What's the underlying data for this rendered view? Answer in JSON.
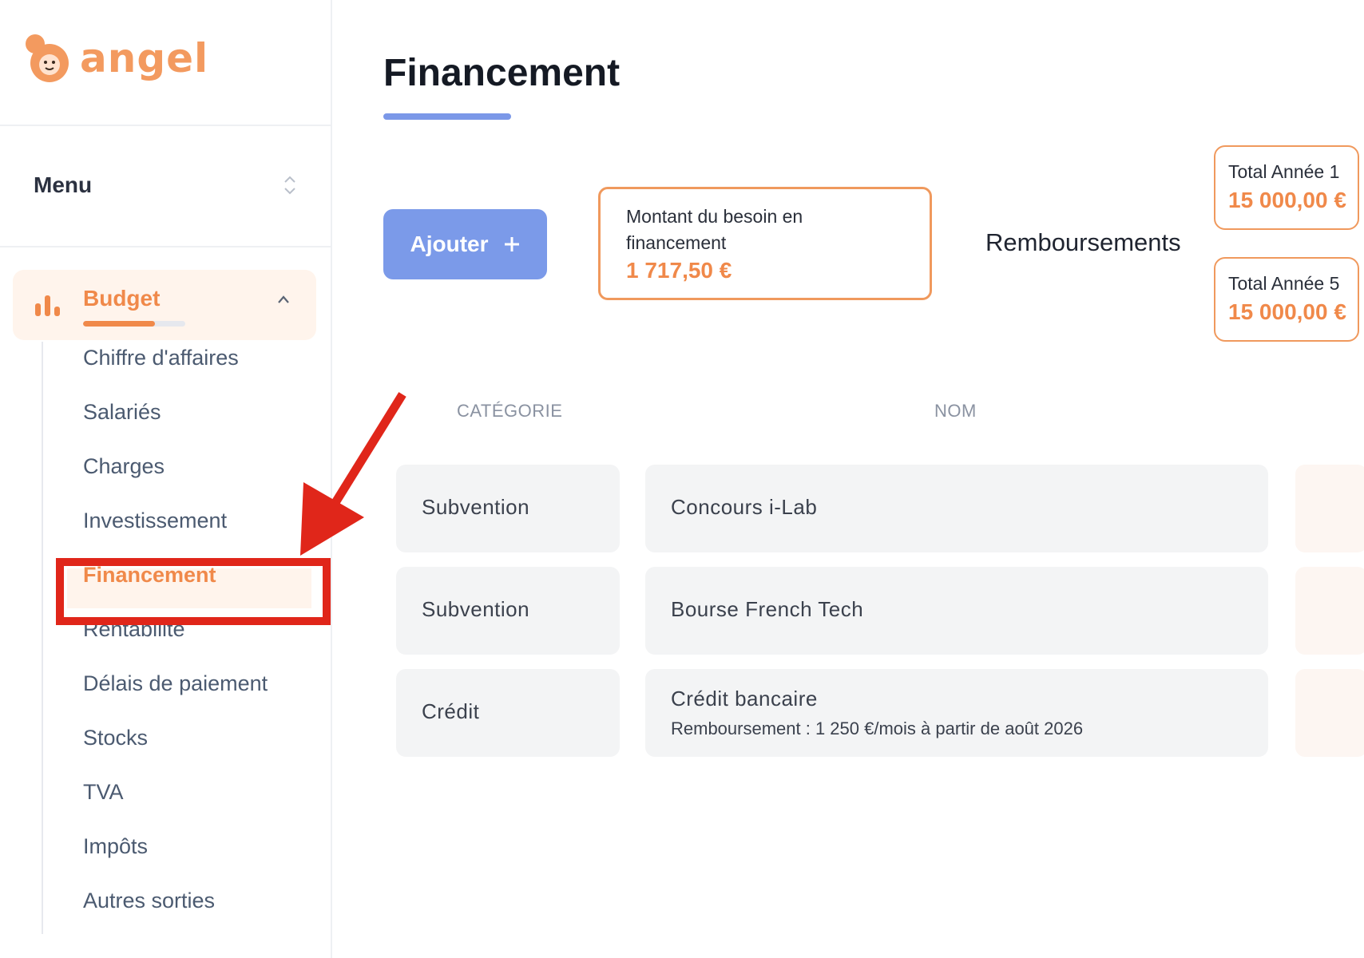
{
  "brand": {
    "name": "angel",
    "color": "#f0894a"
  },
  "sidebar": {
    "menu_label": "Menu",
    "budget_label": "Budget",
    "budget_progress": 0.7,
    "items": [
      {
        "label": "Chiffre d'affaires"
      },
      {
        "label": "Salariés"
      },
      {
        "label": "Charges"
      },
      {
        "label": "Investissement"
      },
      {
        "label": "Financement",
        "active": true
      },
      {
        "label": "Rentabilité"
      },
      {
        "label": "Délais de paiement"
      },
      {
        "label": "Stocks"
      },
      {
        "label": "TVA"
      },
      {
        "label": "Impôts"
      },
      {
        "label": "Autres sorties"
      }
    ]
  },
  "main": {
    "title": "Financement",
    "add_button_label": "Ajouter",
    "need": {
      "label": "Montant du besoin en financement",
      "value": "1 717,50 €"
    },
    "reimbursements_label": "Remboursements",
    "totals": [
      {
        "label": "Total Année 1",
        "value": "15 000,00 €"
      },
      {
        "label": "Total Année 5",
        "value": "15 000,00 €"
      }
    ],
    "table": {
      "headers": {
        "category": "CATÉGORIE",
        "name": "NOM"
      },
      "rows": [
        {
          "category": "Subvention",
          "name": "Concours i-Lab",
          "detail": ""
        },
        {
          "category": "Subvention",
          "name": "Bourse French Tech",
          "detail": ""
        },
        {
          "category": "Crédit",
          "name": "Crédit bancaire",
          "detail": "Remboursement : 1 250 €/mois à partir de août 2026"
        }
      ]
    }
  },
  "colors": {
    "accent_orange": "#f0894a",
    "accent_blue": "#7b9ae9",
    "highlight_red": "#e0261a"
  }
}
